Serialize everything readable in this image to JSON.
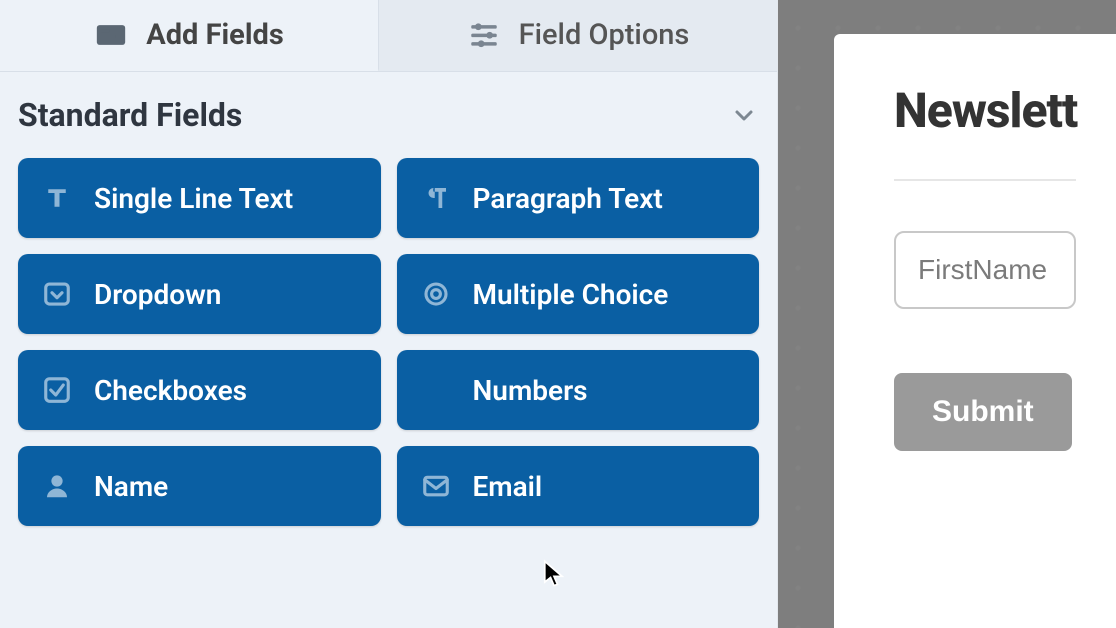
{
  "tabs": {
    "add_fields": "Add Fields",
    "field_options": "Field Options"
  },
  "section": {
    "title": "Standard Fields"
  },
  "fields": {
    "single_line_text": "Single Line Text",
    "paragraph_text": "Paragraph Text",
    "dropdown": "Dropdown",
    "multiple_choice": "Multiple Choice",
    "checkboxes": "Checkboxes",
    "numbers": "Numbers",
    "name": "Name",
    "email": "Email"
  },
  "preview": {
    "title": "Newslett",
    "first_name_placeholder": "FirstName",
    "submit_label": "Submit"
  },
  "colors": {
    "field_button_bg": "#0a5fa3",
    "panel_bg": "#edf2f8",
    "right_bg": "#7e7e7e",
    "submit_bg": "#9a9a9a"
  }
}
